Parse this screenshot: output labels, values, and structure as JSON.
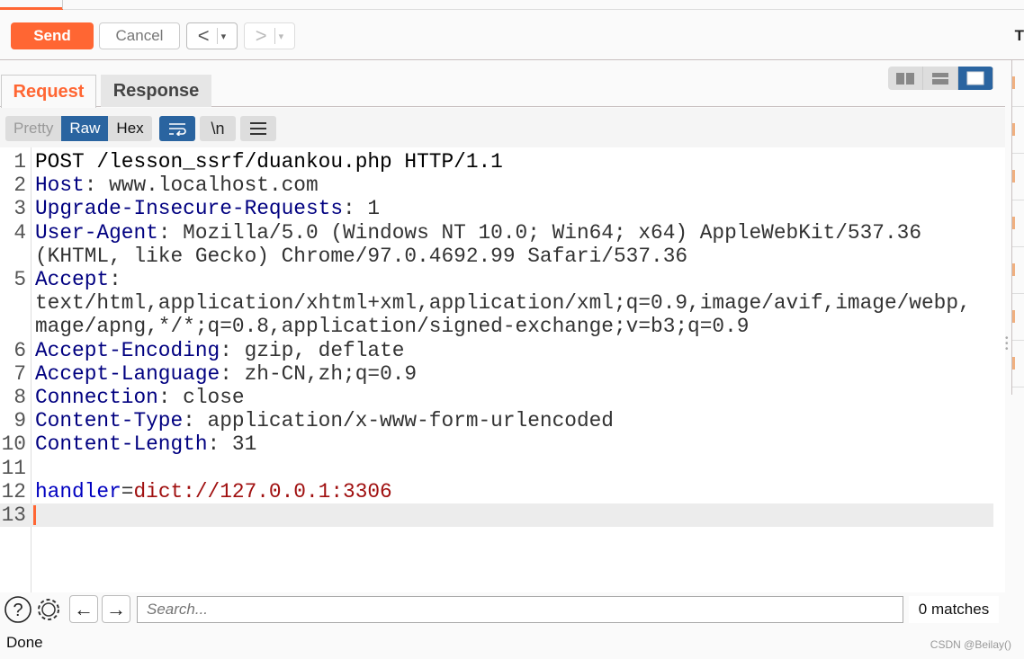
{
  "toolbar": {
    "send": "Send",
    "cancel": "Cancel",
    "back": "<",
    "forward": ">",
    "dropdown": "▾",
    "edge_char": "T"
  },
  "tabs": {
    "request": "Request",
    "response": "Response"
  },
  "view_modes": {
    "options": [
      "split-horizontal",
      "split-vertical",
      "single"
    ],
    "selected": "single"
  },
  "format": {
    "pretty": "Pretty",
    "raw": "Raw",
    "hex": "Hex",
    "newline": "\\n",
    "selected": "Raw"
  },
  "editor": {
    "lines": [
      {
        "n": "1",
        "parts": [
          {
            "t": "POST /lesson_ssrf/duankou.php HTTP/1.1",
            "c": "plain"
          }
        ]
      },
      {
        "n": "2",
        "parts": [
          {
            "t": "Host",
            "c": "hk"
          },
          {
            "t": ": www.localhost.com",
            "c": "hv"
          }
        ]
      },
      {
        "n": "3",
        "parts": [
          {
            "t": "Upgrade-Insecure-Requests",
            "c": "hk"
          },
          {
            "t": ": 1",
            "c": "hv"
          }
        ]
      },
      {
        "n": "4",
        "parts": [
          {
            "t": "User-Agent",
            "c": "hk"
          },
          {
            "t": ": Mozilla/5.0 (Windows NT 10.0; Win64; x64) AppleWebKit/537.36",
            "c": "hv"
          }
        ]
      },
      {
        "n": "",
        "parts": [
          {
            "t": "(KHTML, like Gecko) Chrome/97.0.4692.99 Safari/537.36",
            "c": "hv"
          }
        ]
      },
      {
        "n": "5",
        "parts": [
          {
            "t": "Accept",
            "c": "hk"
          },
          {
            "t": ":",
            "c": "hv"
          }
        ]
      },
      {
        "n": "",
        "parts": [
          {
            "t": "text/html,application/xhtml+xml,application/xml;q=0.9,image/avif,image/webp,",
            "c": "hv"
          }
        ]
      },
      {
        "n": "",
        "parts": [
          {
            "t": "mage/apng,*/*;q=0.8,application/signed-exchange;v=b3;q=0.9",
            "c": "hv"
          }
        ]
      },
      {
        "n": "6",
        "parts": [
          {
            "t": "Accept-Encoding",
            "c": "hk"
          },
          {
            "t": ": gzip, deflate",
            "c": "hv"
          }
        ]
      },
      {
        "n": "7",
        "parts": [
          {
            "t": "Accept-Language",
            "c": "hk"
          },
          {
            "t": ": zh-CN,zh;q=0.9",
            "c": "hv"
          }
        ]
      },
      {
        "n": "8",
        "parts": [
          {
            "t": "Connection",
            "c": "hk"
          },
          {
            "t": ": close",
            "c": "hv"
          }
        ]
      },
      {
        "n": "9",
        "parts": [
          {
            "t": "Content-Type",
            "c": "hk"
          },
          {
            "t": ": application/x-www-form-urlencoded",
            "c": "hv"
          }
        ]
      },
      {
        "n": "10",
        "parts": [
          {
            "t": "Content-Length",
            "c": "hk"
          },
          {
            "t": ": 31",
            "c": "hv"
          }
        ]
      },
      {
        "n": "11",
        "parts": []
      },
      {
        "n": "12",
        "parts": [
          {
            "t": "handler",
            "c": "pk"
          },
          {
            "t": "=",
            "c": "hv"
          },
          {
            "t": "dict://127.0.0.1:3306",
            "c": "pv"
          }
        ]
      },
      {
        "n": "13",
        "parts": [],
        "current": true
      }
    ]
  },
  "search": {
    "placeholder": "Search...",
    "matches": "0 matches"
  },
  "status": "Done",
  "watermark": "CSDN @Beilay()",
  "colors": {
    "accent": "#ff6633",
    "selected": "#2a64a0",
    "header_key": "#000080",
    "param_key": "#0000c0",
    "param_value": "#a01010"
  }
}
